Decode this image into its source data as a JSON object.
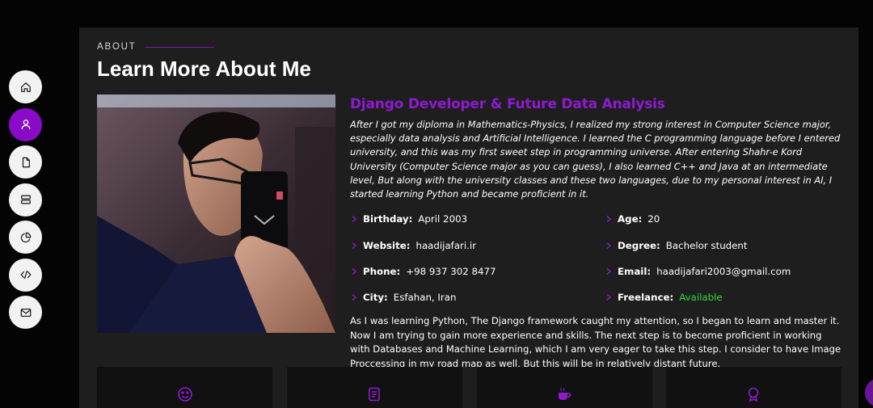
{
  "nav": {
    "items": [
      {
        "icon": "home-icon",
        "active": false
      },
      {
        "icon": "user-icon",
        "active": true
      },
      {
        "icon": "file-icon",
        "active": false
      },
      {
        "icon": "server-icon",
        "active": false
      },
      {
        "icon": "pie-chart-icon",
        "active": false
      },
      {
        "icon": "code-icon",
        "active": false
      },
      {
        "icon": "mail-icon",
        "active": false
      }
    ]
  },
  "about": {
    "label": "ABOUT",
    "title": "Learn More About Me",
    "role": "Django Developer & Future Data Analysis",
    "intro": "After I got my diploma in Mathematics-Physics, I realized my strong interest in Computer Science major, especially data analysis and Artificial Intelligence. I learned the C programming language before I entered university, and this was my first sweet step in programming universe. After entering Shahr-e Kord University (Computer Science major as you can guess), I also learned C++ and Java at an intermediate level, But along with the university classes and these two languages, due to my personal interest in AI, I started learning Python and became proficient in it.",
    "facts_left": [
      {
        "key": "Birthday:",
        "value": "April 2003"
      },
      {
        "key": "Website:",
        "value": "haadijafari.ir"
      },
      {
        "key": "Phone:",
        "value": "+98 937 302 8477"
      },
      {
        "key": "City:",
        "value": "Esfahan, Iran"
      }
    ],
    "facts_right": [
      {
        "key": "Age:",
        "value": "20"
      },
      {
        "key": "Degree:",
        "value": "Bachelor student"
      },
      {
        "key": "Email:",
        "value": "haadijafari2003@gmail.com"
      },
      {
        "key": "Freelance:",
        "value": "Available"
      }
    ],
    "outro": "As I was learning Python, The Django framework caught my attention, so I began to learn and master it. Now I am trying to gain more experience and skills. The next step is to become proficient in working with Databases and Machine Learning, which I am very eager to take this step. I consider to have Image Proccessing in my road map as well, But this will be in relatively distant future."
  },
  "stats": [
    {
      "icon": "smiley-icon"
    },
    {
      "icon": "journal-icon"
    },
    {
      "icon": "coffee-cup-icon"
    },
    {
      "icon": "award-icon"
    }
  ],
  "colors": {
    "accent": "#8f1ad1",
    "nav_active": "#8a0bc7",
    "card_bg": "#1e1e1e",
    "available": "#35d63f"
  }
}
